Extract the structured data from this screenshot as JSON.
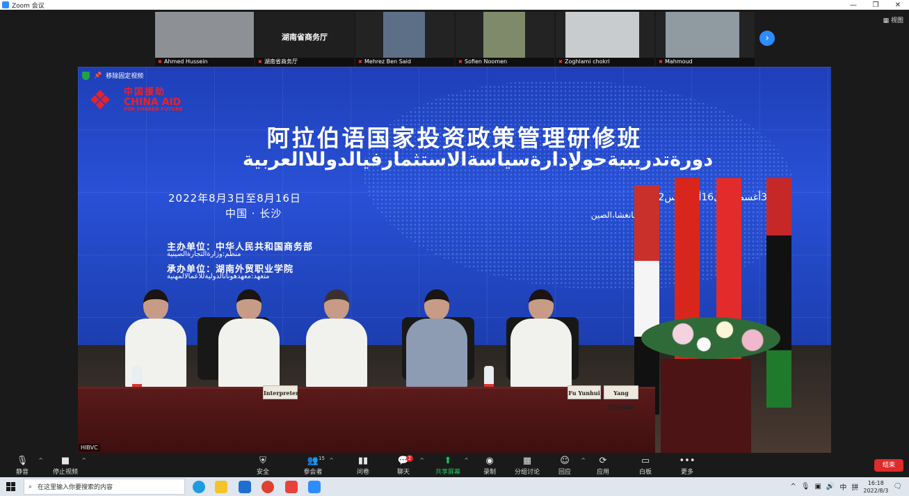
{
  "window": {
    "title": "Zoom 会议",
    "minimize": "—",
    "restore": "❐",
    "close": "✕"
  },
  "view_button": "视图",
  "participants": [
    {
      "name": "Ahmed Hussein",
      "has_video": true
    },
    {
      "name": "湖南省商务厅",
      "has_video": false,
      "display": "湖南省商务厅"
    },
    {
      "name": "Mehrez Ben Said",
      "has_video": true
    },
    {
      "name": "Sofien Noomen",
      "has_video": true
    },
    {
      "name": "Zoghlami chokri",
      "has_video": true
    },
    {
      "name": "Mahmoud",
      "has_video": true
    }
  ],
  "pin_label": "移除固定视频",
  "slide": {
    "logo_cn": "中国援助",
    "logo_en": "CHINA AID",
    "logo_sub": "FOR SHARED FUTURE",
    "title_cn": "阿拉伯语国家投资政策管理研修班",
    "title_ar": "دورةتدريبيةحولإدارةسياسةالاستثمارفيالدوللاالعربية",
    "date_cn": "2022年8月3日至8月16日",
    "place_cn": "中国 · 长沙",
    "date_ar": "3أغسطسإلى16أغسطس2022",
    "place_ar": "تشانغشا،الصين",
    "org1": "主办单位：中华人民共和国商务部",
    "org1_ar": "منظم:وزارةالتجارةالصينية",
    "org2": "承办单位：湖南外贸职业学院",
    "org2_ar": "متعهد:معهدهونانالدوليةللاعمالالمهنية"
  },
  "nameplates": [
    "Interpreter",
    "Fu Yunhui",
    "Yang Zhiyuan"
  ],
  "video_label": "HIBVC",
  "toolbar": {
    "mute": "静音",
    "stop_video": "停止视频",
    "security": "安全",
    "participants": "参会者",
    "participant_count": "15",
    "polls": "问卷",
    "chat": "聊天",
    "chat_badge": "2",
    "share": "共享屏幕",
    "record": "录制",
    "breakout": "分组讨论",
    "reactions": "回应",
    "apps": "应用",
    "whiteboard": "白板",
    "more": "更多",
    "end": "结束"
  },
  "taskbar": {
    "search_placeholder": "在这里输入你要搜索的内容",
    "ime_lang": "中",
    "ime_mode": "拼",
    "time": "16:18",
    "date": "2022/8/3"
  },
  "colors": {
    "zoom_blue": "#2d8cff",
    "end_red": "#e02b2b",
    "share_green": "#22c55e",
    "slide_blue": "#2950d6"
  }
}
